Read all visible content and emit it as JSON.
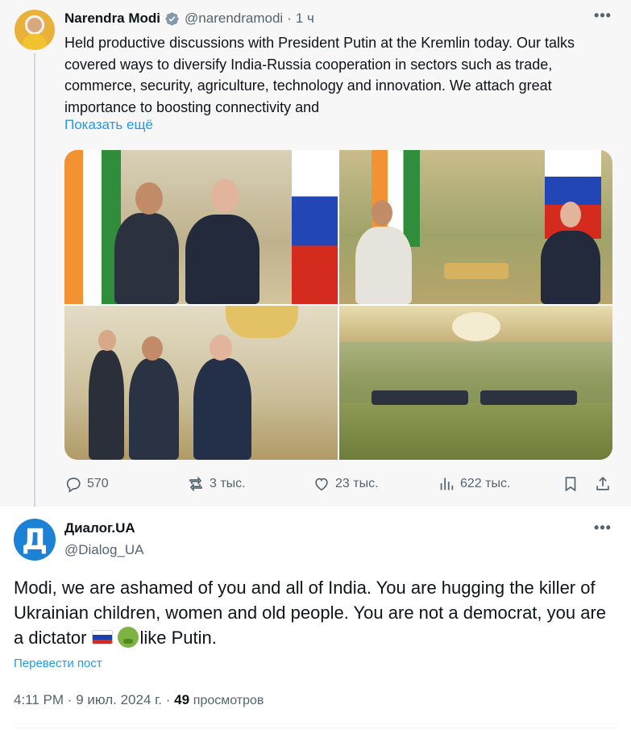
{
  "parent_tweet": {
    "author_name": "Narendra Modi",
    "handle": "@narendramodi",
    "separator": "·",
    "time": "1 ч",
    "text": "Held productive discussions with President Putin at the Kremlin today. Our talks covered ways to diversify India-Russia cooperation in sectors such as trade, commerce, security, agriculture, technology and innovation. We attach great importance to boosting connectivity and",
    "show_more": "Показать ещё",
    "more_icon": "•••",
    "stats": {
      "replies": "570",
      "reposts": "3 тыс.",
      "likes": "23 тыс.",
      "views": "622 тыс."
    }
  },
  "reply_tweet": {
    "avatar_letter": "Д",
    "author_name": "Диалог.UA",
    "handle": "@Dialog_UA",
    "more_icon": "•••",
    "text_main": "Modi, we are ashamed of you and all of India. You are hugging the killer of Ukrainian children, women and old people. You are not a democrat, you are a dictator",
    "text_tail": "like Putin.",
    "translate": "Перевести пост",
    "time": "4:11 PM",
    "date": "9 июл. 2024 г.",
    "views_count": "49",
    "views_label": "просмотров"
  },
  "colors": {
    "accent": "#1d9bf0",
    "muted": "#536471",
    "text": "#0f1419"
  }
}
